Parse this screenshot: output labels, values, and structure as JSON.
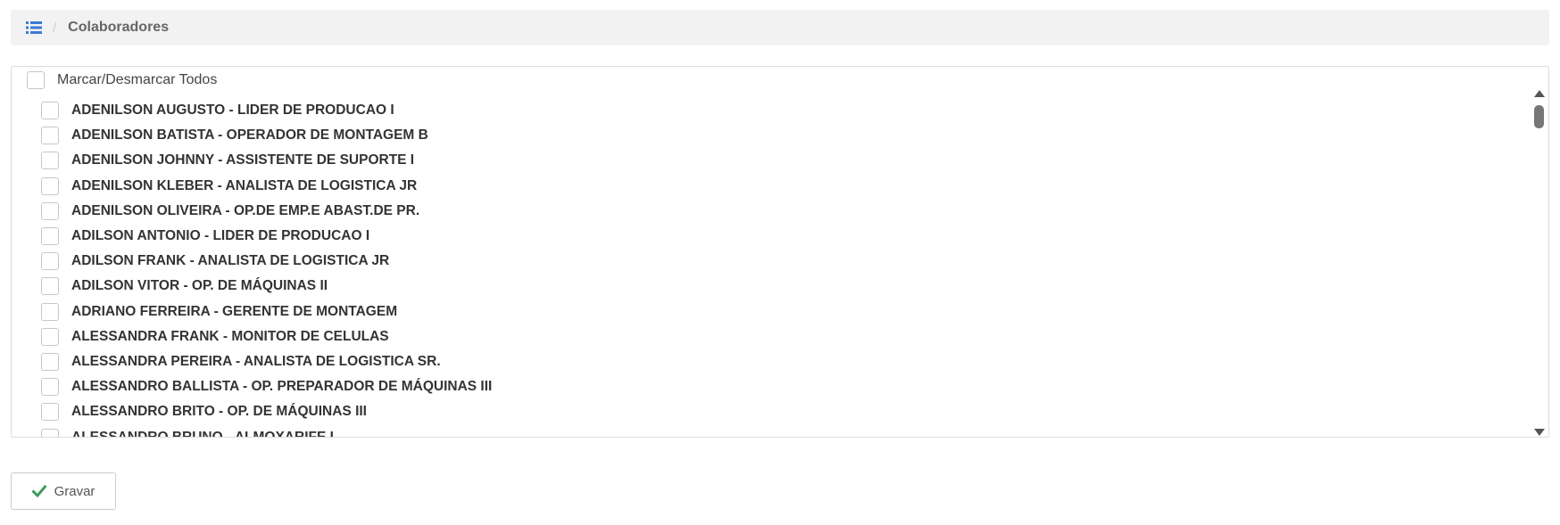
{
  "breadcrumb": {
    "icon": "list-icon",
    "separator": "/",
    "title": "Colaboradores"
  },
  "select_all": {
    "label": "Marcar/Desmarcar Todos",
    "checked": false
  },
  "employees": [
    {
      "label": "ADENILSON AUGUSTO - LIDER DE PRODUCAO I",
      "checked": false
    },
    {
      "label": "ADENILSON BATISTA - OPERADOR DE MONTAGEM B",
      "checked": false
    },
    {
      "label": "ADENILSON JOHNNY - ASSISTENTE DE SUPORTE I",
      "checked": false
    },
    {
      "label": "ADENILSON KLEBER - ANALISTA DE LOGISTICA JR",
      "checked": false
    },
    {
      "label": "ADENILSON OLIVEIRA - OP.DE EMP.E ABAST.DE PR.",
      "checked": false
    },
    {
      "label": "ADILSON ANTONIO - LIDER DE PRODUCAO I",
      "checked": false
    },
    {
      "label": "ADILSON FRANK - ANALISTA DE LOGISTICA JR",
      "checked": false
    },
    {
      "label": "ADILSON VITOR - OP. DE MÁQUINAS II",
      "checked": false
    },
    {
      "label": "ADRIANO FERREIRA - GERENTE DE MONTAGEM",
      "checked": false
    },
    {
      "label": "ALESSANDRA FRANK - MONITOR DE CELULAS",
      "checked": false
    },
    {
      "label": "ALESSANDRA PEREIRA - ANALISTA DE LOGISTICA SR.",
      "checked": false
    },
    {
      "label": "ALESSANDRO BALLISTA - OP. PREPARADOR DE MÁQUINAS III",
      "checked": false
    },
    {
      "label": "ALESSANDRO BRITO - OP. DE MÁQUINAS III",
      "checked": false
    },
    {
      "label": "ALESSANDRO BRUNO - ALMOXARIFE I",
      "checked": false
    }
  ],
  "save_button": {
    "label": "Gravar",
    "icon": "check-icon"
  },
  "colors": {
    "breadcrumb_bg": "#f2f2f2",
    "link_blue": "#3a7bd5",
    "check_green": "#3c9a5f"
  }
}
